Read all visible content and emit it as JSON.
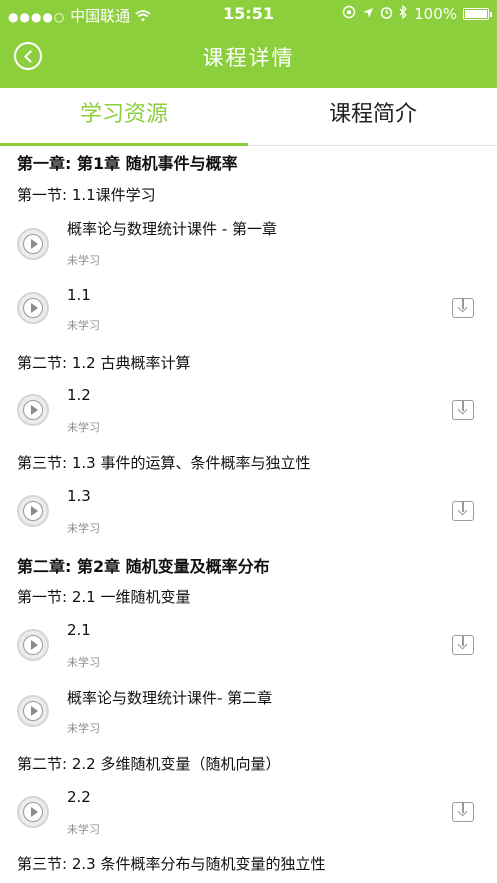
{
  "status_bar": {
    "signal": "●●●●○",
    "carrier": "中国联通",
    "wifi_icon": "wifi-icon",
    "time": "15:51",
    "battery_percent": "100%"
  },
  "nav": {
    "title": "课程详情"
  },
  "tabs": {
    "active": "学习资源",
    "inactive": "课程简介"
  },
  "content": {
    "ch1": "第一章: 第1章 随机事件与概率",
    "sec1_1": "第一节: 1.1课件学习",
    "item1": {
      "title": "概率论与数理统计课件 - 第一章",
      "status": "未学习"
    },
    "item2": {
      "title": "1.1",
      "status": "未学习"
    },
    "sec1_2": "第二节: 1.2 古典概率计算",
    "item3": {
      "title": "1.2",
      "status": "未学习"
    },
    "sec1_3": "第三节: 1.3 事件的运算、条件概率与独立性",
    "item4": {
      "title": "1.3",
      "status": "未学习"
    },
    "ch2": "第二章: 第2章 随机变量及概率分布",
    "sec2_1": "第一节: 2.1 一维随机变量",
    "item5": {
      "title": "2.1",
      "status": "未学习"
    },
    "item6": {
      "title": "概率论与数理统计课件- 第二章",
      "status": "未学习"
    },
    "sec2_2": "第二节: 2.2 多维随机变量（随机向量）",
    "item7": {
      "title": "2.2",
      "status": "未学习"
    },
    "sec2_3": "第三节: 2.3 条件概率分布与随机变量的独立性"
  }
}
